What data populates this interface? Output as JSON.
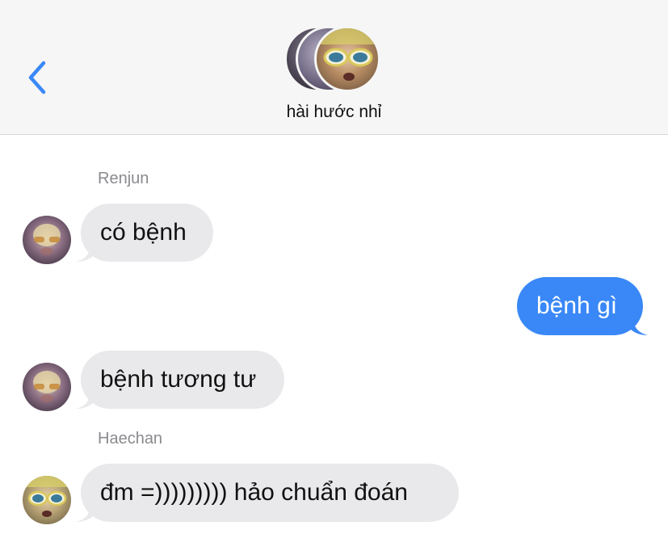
{
  "header": {
    "back_icon": "chevron-left-icon",
    "group_name": "hài hước nhỉ",
    "accent_color": "#3a88f7"
  },
  "messages": [
    {
      "sender": "Renjun",
      "text": "có bệnh",
      "direction": "incoming"
    },
    {
      "text": "bệnh gì",
      "direction": "outgoing"
    },
    {
      "text": "bệnh tương tư",
      "direction": "incoming"
    },
    {
      "sender": "Haechan",
      "text": "đm =))))))))) hảo chuẩn đoán",
      "direction": "incoming"
    }
  ],
  "colors": {
    "incoming_bubble": "#e9e9eb",
    "outgoing_bubble": "#3a88f7",
    "sender_label": "#8a8a8f"
  }
}
